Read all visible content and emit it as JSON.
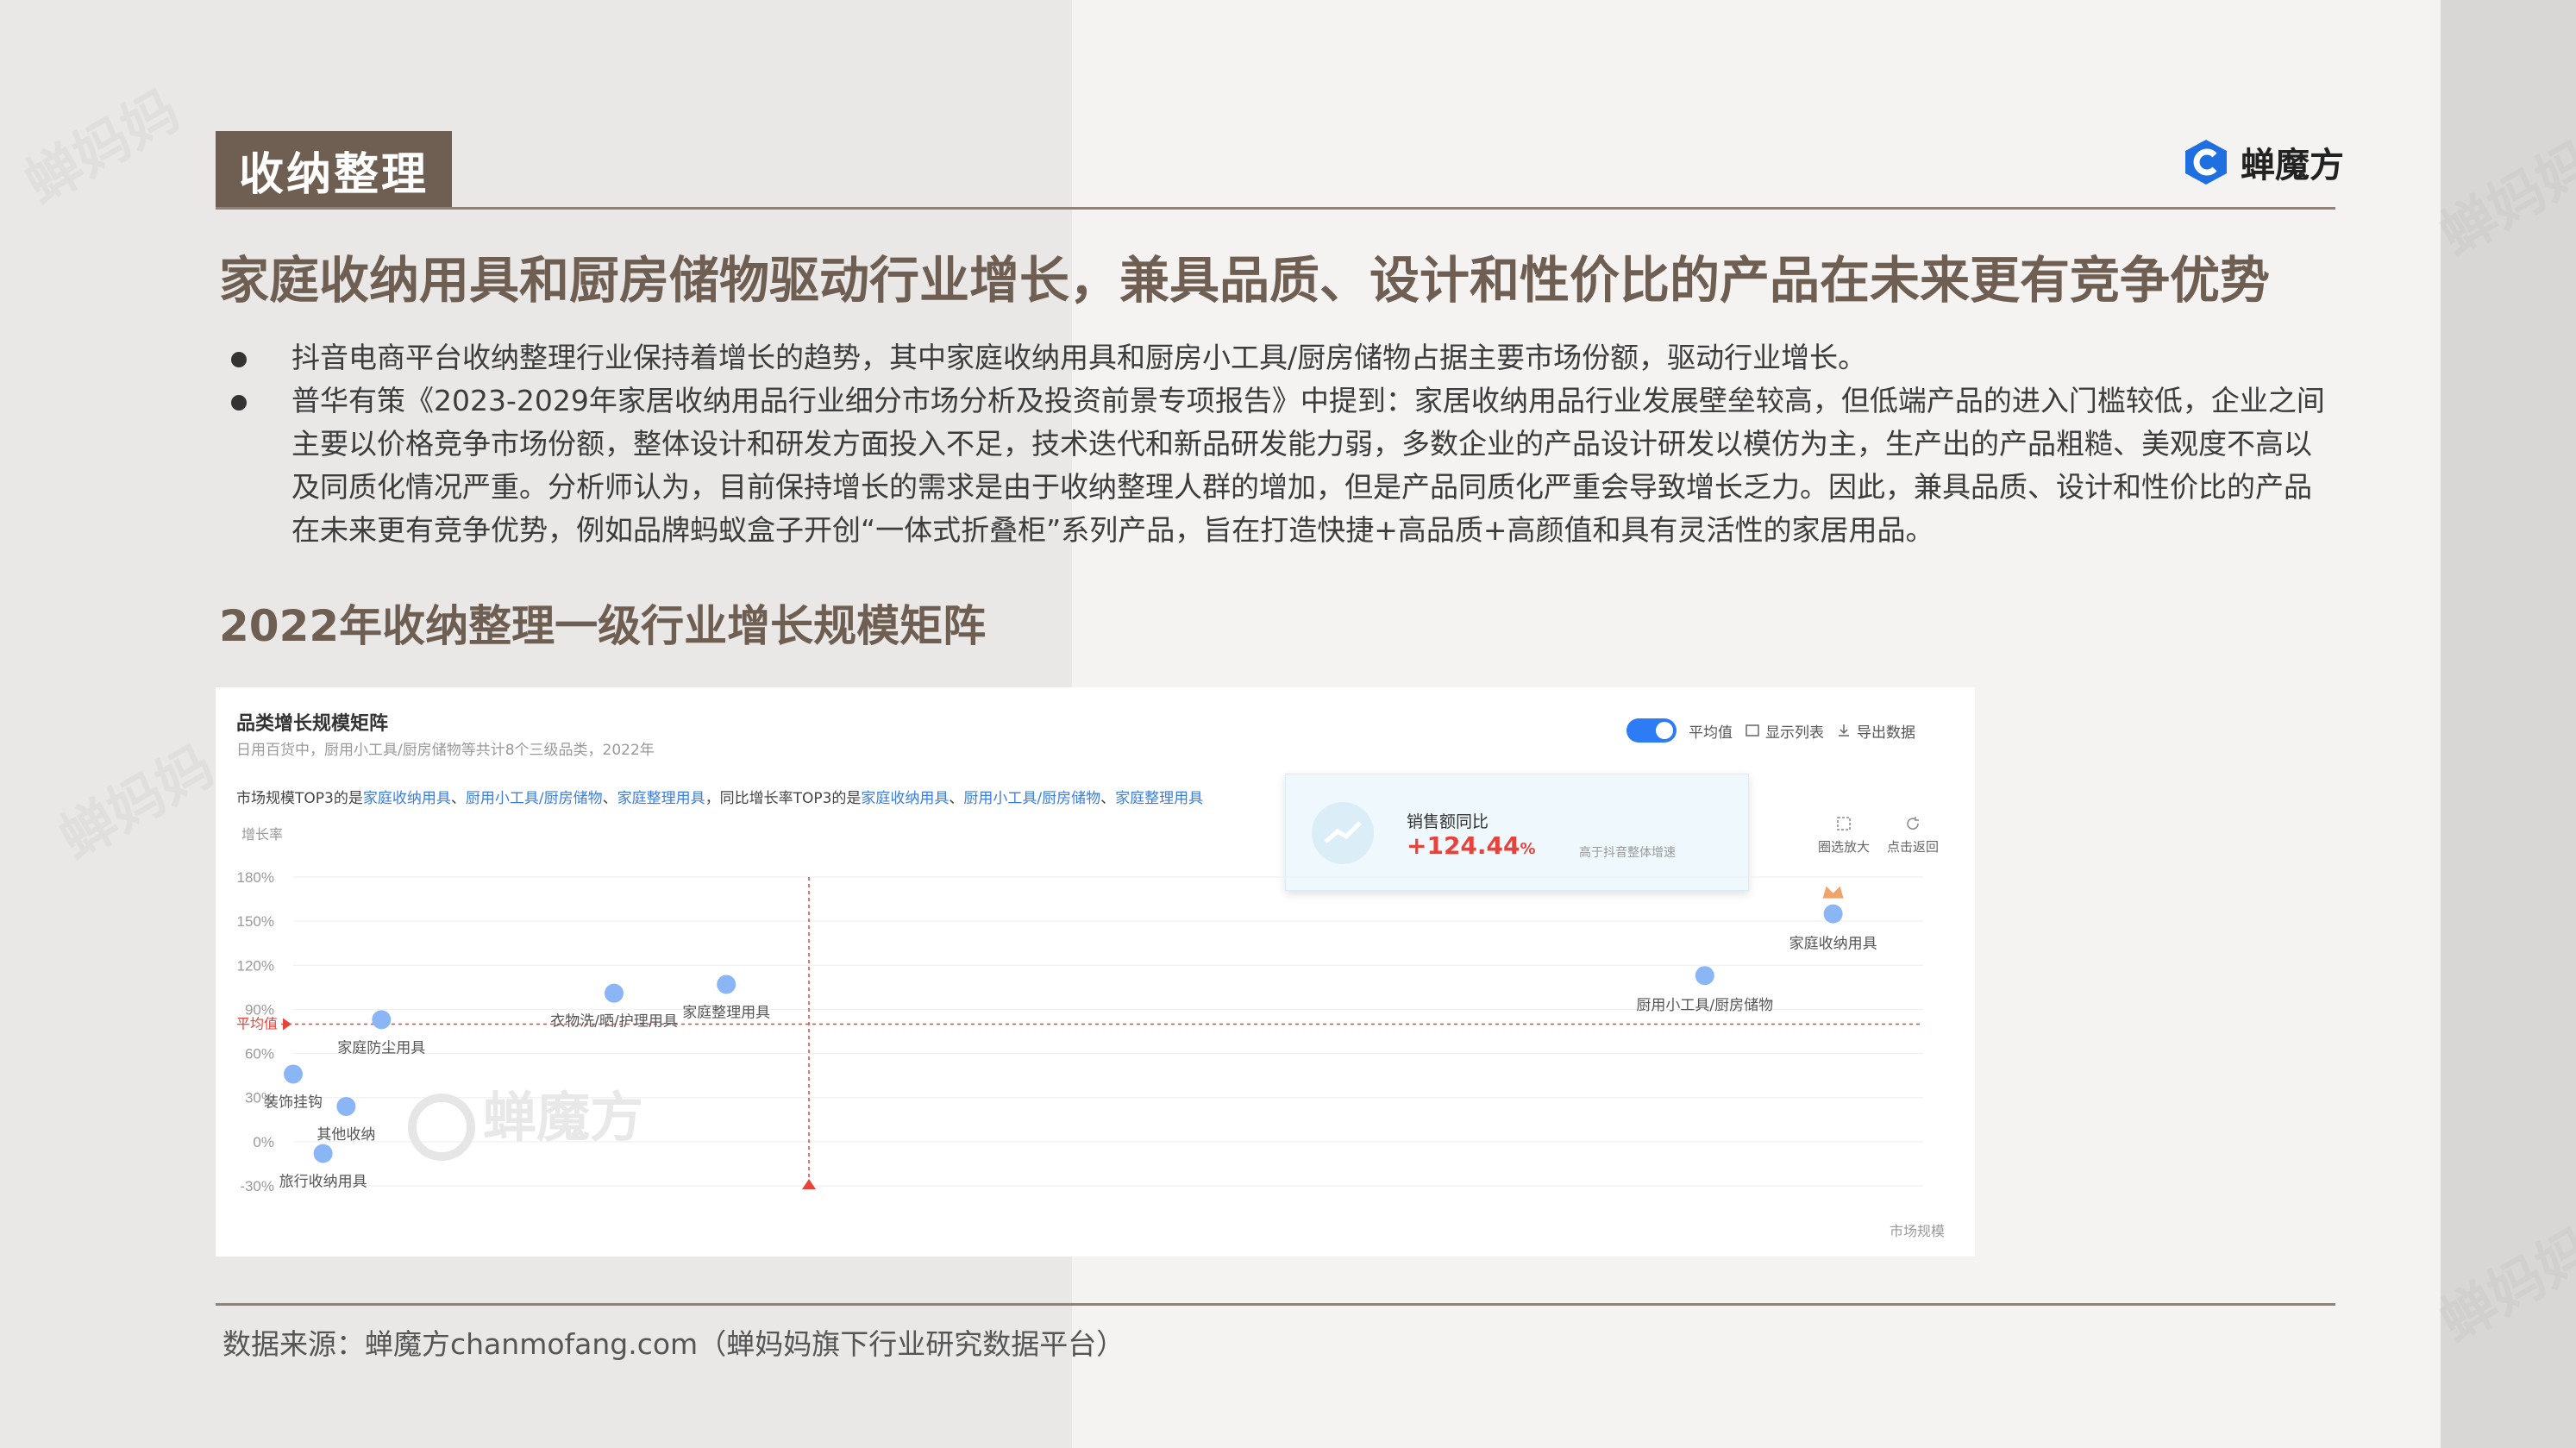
{
  "header": {
    "tag": "收纳整理",
    "logo_text": "蝉魔方",
    "logo_icon": "chanmofang-logo-icon"
  },
  "headline": "家庭收纳用具和厨房储物驱动行业增长，兼具品质、设计和性价比的产品在未来更有竞争优势",
  "bullets": [
    "抖音电商平台收纳整理行业保持着增长的趋势，其中家庭收纳用具和厨房小工具/厨房储物占据主要市场份额，驱动行业增长。",
    "普华有策《2023-2029年家居收纳用品行业细分市场分析及投资前景专项报告》中提到：家居收纳用品行业发展壁垒较高，但低端产品的进入门槛较低，企业之间主要以价格竞争市场份额，整体设计和研发方面投入不足，技术迭代和新品研发能力弱，多数企业的产品设计研发以模仿为主，生产出的产品粗糙、美观度不高以及同质化情况严重。分析师认为，目前保持增长的需求是由于收纳整理人群的增加，但是产品同质化严重会导致增长乏力。因此，兼具品质、设计和性价比的产品在未来更有竞争优势，例如品牌蚂蚁盒子开创“一体式折叠柜”系列产品，旨在打造快捷+高品质+高颜值和具有灵活性的家居用品。"
  ],
  "subheading": "2022年收纳整理一级行业增长规模矩阵",
  "panel": {
    "title": "品类增长规模矩阵",
    "subtitle": "日用百货中，厨用小工具/厨房储物等共计8个三级品类，2022年",
    "note_prefix": "市场规模TOP3的是",
    "note_top_size": [
      "家庭收纳用具",
      "厨用小工具/厨房储物",
      "家庭整理用具"
    ],
    "note_middle": "，同比增长率TOP3的是",
    "note_top_growth": [
      "家庭收纳用具",
      "厨用小工具/厨房储物",
      "家庭整理用具"
    ],
    "toggle_label": "平均值",
    "show_list": "显示列表",
    "export": "导出数据",
    "zoom_select": "圈选放大",
    "click_back": "点击返回",
    "watermark": "蝉魔方",
    "callout": {
      "label": "销售额同比",
      "value": "+124.44",
      "unit": "%",
      "desc": "高于抖音整体增速"
    }
  },
  "chart_data": {
    "type": "scatter",
    "ylabel": "增长率",
    "xlabel": "市场规模",
    "y_ticks": [
      "180%",
      "150%",
      "120%",
      "90%",
      "60%",
      "30%",
      "0%",
      "-30%"
    ],
    "ylim": [
      -30,
      180
    ],
    "average_label": "平均值",
    "average_y": 80,
    "x_units": "relative",
    "points": [
      {
        "name": "家庭收纳用具",
        "x": 0.96,
        "y": 155,
        "highlight": true
      },
      {
        "name": "厨用小工具/厨房储物",
        "x": 0.88,
        "y": 113
      },
      {
        "name": "家庭整理用具",
        "x": 0.27,
        "y": 107
      },
      {
        "name": "衣物洗/晒/护理用具",
        "x": 0.2,
        "y": 101
      },
      {
        "name": "家庭防尘用具",
        "x": 0.055,
        "y": 83
      },
      {
        "name": "装饰挂钩",
        "x": 0.0,
        "y": 46
      },
      {
        "name": "其他收纳",
        "x": 0.033,
        "y": 24
      },
      {
        "name": "旅行收纳用具",
        "x": 0.01,
        "y": -8
      }
    ],
    "colors": {
      "point": "#8ab6f5",
      "average_line": "#e8423a",
      "grid": "#eeeeee"
    }
  },
  "source": "数据来源：蝉魔方chanmofang.com（蝉妈妈旗下行业研究数据平台）"
}
